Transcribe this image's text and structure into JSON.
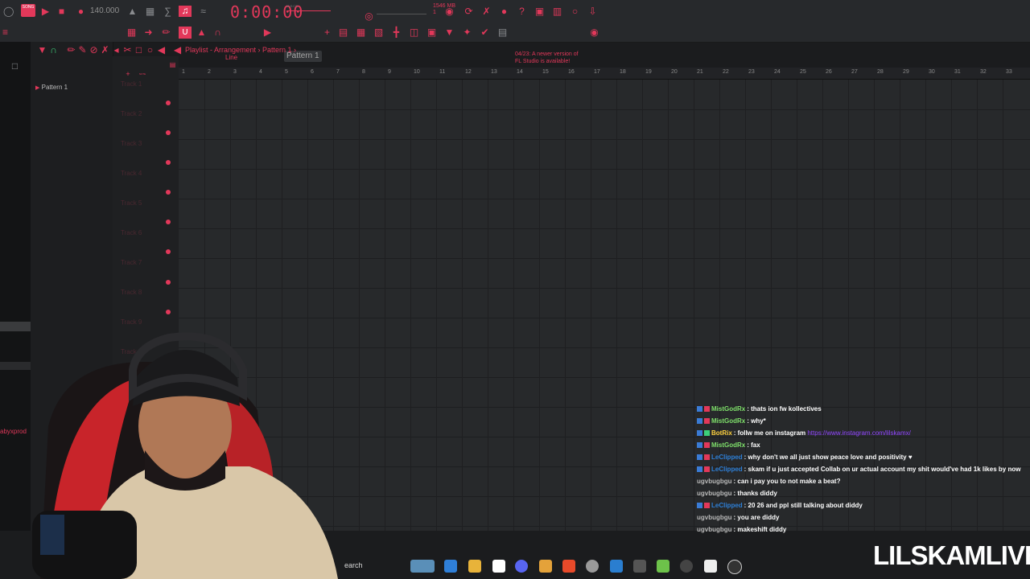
{
  "app": {
    "song_mode": "SONG",
    "bpm": "140.000",
    "time": "0:00:00",
    "time_label": "M:S:CS",
    "memory": "1546 MB",
    "memory_sub": "1",
    "snap": "Line",
    "pattern": "Pattern 1",
    "notice_line1": "04/23: A newer version of",
    "notice_line2": "FL Studio is available!"
  },
  "playlist": {
    "breadcrumb": "Playlist - Arrangement › Pattern 1 ›",
    "pattern_item": "Pattern 1",
    "ruler": [
      "1",
      "2",
      "3",
      "4",
      "5",
      "6",
      "7",
      "8",
      "9",
      "10",
      "11",
      "12",
      "13",
      "14",
      "15",
      "16",
      "17",
      "18",
      "19",
      "20",
      "21",
      "22",
      "23",
      "24",
      "25",
      "26",
      "27",
      "28",
      "29",
      "30",
      "31",
      "32",
      "33"
    ],
    "tracks": [
      "Track 1",
      "Track 2",
      "Track 3",
      "Track 4",
      "Track 5",
      "Track 6",
      "Track 7",
      "Track 8",
      "Track 9",
      "Track 10"
    ]
  },
  "chat": [
    {
      "user": "MistGodRx",
      "color": "#7fe06b",
      "msg": "thats ion fw kollectives"
    },
    {
      "user": "MistGodRx",
      "color": "#7fe06b",
      "msg": "why*"
    },
    {
      "user": "BotRix",
      "color": "#ffd23f",
      "msg": "follw me on instagram",
      "link": "https://www.instagram.com/lilskamx/"
    },
    {
      "user": "MistGodRx",
      "color": "#7fe06b",
      "msg": "fax"
    },
    {
      "user": "LeClipped",
      "color": "#2d7fd6",
      "msg": "why don't we all just show peace love and positivity ♥"
    },
    {
      "user": "LeClipped",
      "color": "#2d7fd6",
      "msg": "skam if u just accepted Collab on ur actual account my shit would've had 1k likes by now"
    },
    {
      "user": "ugvbugbgu",
      "color": "#b8b8b8",
      "msg": "can i pay you to not make a beat?"
    },
    {
      "user": "ugvbugbgu",
      "color": "#b8b8b8",
      "msg": "thanks diddy"
    },
    {
      "user": "LeClipped",
      "color": "#2d7fd6",
      "msg": "20 26 and ppl still talking about diddy"
    },
    {
      "user": "ugvbugbgu",
      "color": "#b8b8b8",
      "msg": "you are diddy"
    },
    {
      "user": "ugvbugbgu",
      "color": "#b8b8b8",
      "msg": "makeshift diddy"
    }
  ],
  "overlay": {
    "watermark": "LILSKAMLIVE",
    "side_label": "abyxprod",
    "taskbar_search": "earch"
  },
  "colors": {
    "accent": "#e2385a",
    "background": "#1b1c1e",
    "grid": "#27292b"
  }
}
